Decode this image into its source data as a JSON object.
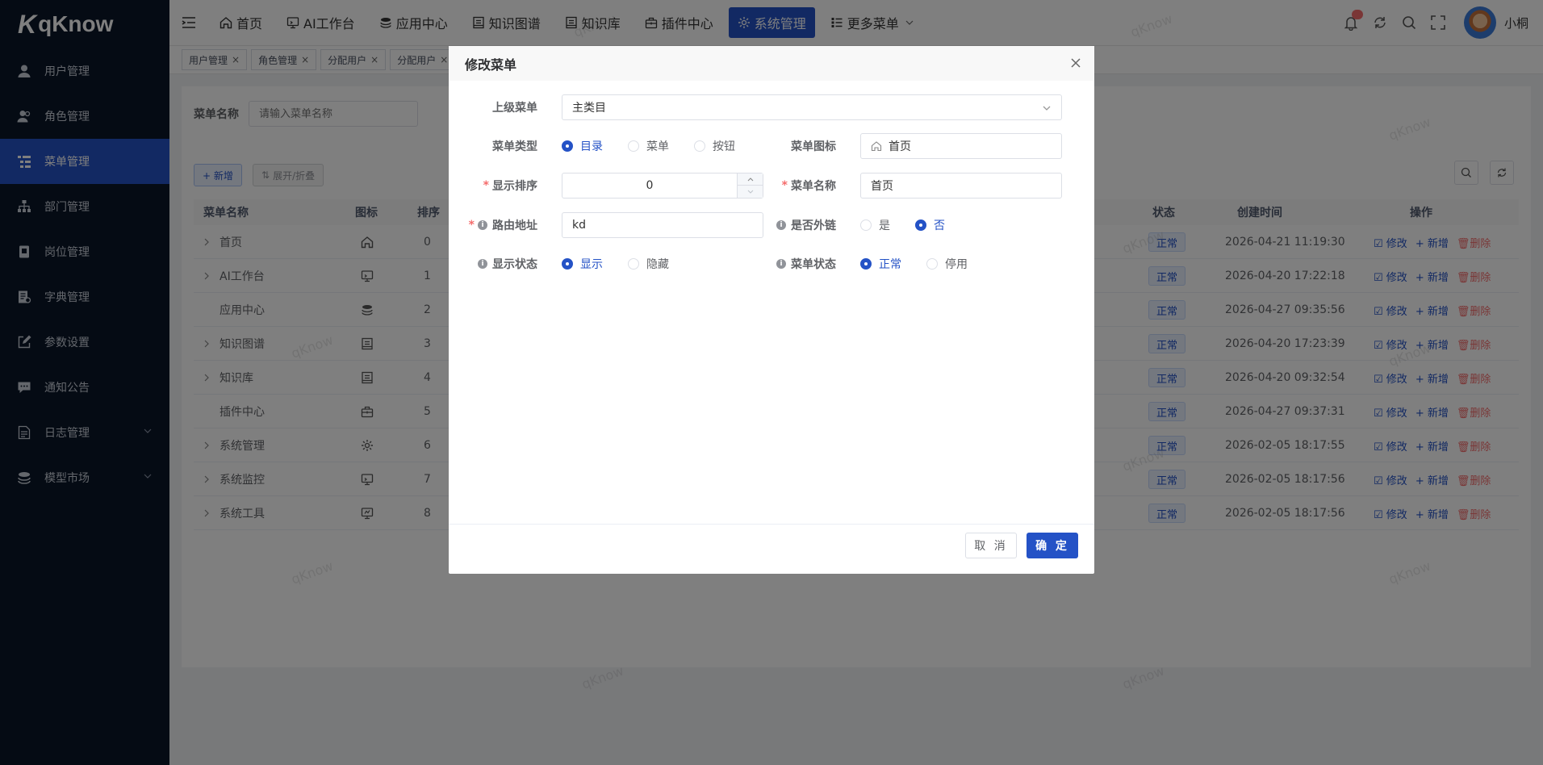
{
  "brand": {
    "name": "qKnow",
    "mark": "K"
  },
  "sidebar": {
    "items": [
      {
        "label": "用户管理",
        "icon": "user-icon"
      },
      {
        "label": "角色管理",
        "icon": "role-icon"
      },
      {
        "label": "菜单管理",
        "icon": "menu-tree-icon",
        "active": true
      },
      {
        "label": "部门管理",
        "icon": "org-chart-icon"
      },
      {
        "label": "岗位管理",
        "icon": "post-icon"
      },
      {
        "label": "字典管理",
        "icon": "dict-icon"
      },
      {
        "label": "参数设置",
        "icon": "edit-icon"
      },
      {
        "label": "通知公告",
        "icon": "message-icon"
      },
      {
        "label": "日志管理",
        "icon": "log-icon",
        "has_children": true
      },
      {
        "label": "模型市场",
        "icon": "model-icon",
        "has_children": true
      }
    ]
  },
  "topnav": {
    "items": [
      {
        "label": "首页",
        "icon": "home-icon"
      },
      {
        "label": "AI工作台",
        "icon": "monitor-icon"
      },
      {
        "label": "应用中心",
        "icon": "app-icon"
      },
      {
        "label": "知识图谱",
        "icon": "book-icon"
      },
      {
        "label": "知识库",
        "icon": "book-icon"
      },
      {
        "label": "插件中心",
        "icon": "plugin-icon"
      },
      {
        "label": "系统管理",
        "icon": "gear-icon",
        "active": true
      },
      {
        "label": "更多菜单",
        "icon": "list-icon",
        "dropdown": true
      }
    ],
    "user": "小桐"
  },
  "tags": [
    "用户管理",
    "角色管理",
    "分配用户",
    "分配用户"
  ],
  "search": {
    "label": "菜单名称",
    "placeholder": "请输入菜单名称"
  },
  "toolbar": {
    "add": "+ 新增",
    "expand": "展开/折叠"
  },
  "table": {
    "headers": {
      "name": "菜单名称",
      "icon": "图标",
      "order": "排序",
      "status": "状态",
      "created": "创建时间",
      "ops": "操作"
    },
    "rows": [
      {
        "name": "首页",
        "icon": "home-icon",
        "order": "0",
        "status": "正常",
        "created": "2026-04-21 11:19:30",
        "expandable": true
      },
      {
        "name": "AI工作台",
        "icon": "monitor-icon",
        "order": "1",
        "status": "正常",
        "created": "2026-04-20 17:22:18",
        "expandable": true
      },
      {
        "name": "应用中心",
        "icon": "app-icon",
        "order": "2",
        "status": "正常",
        "created": "2026-04-27 09:35:56",
        "expandable": false
      },
      {
        "name": "知识图谱",
        "icon": "book-icon",
        "order": "3",
        "status": "正常",
        "created": "2026-04-20 17:23:39",
        "expandable": true
      },
      {
        "name": "知识库",
        "icon": "book-icon",
        "order": "4",
        "status": "正常",
        "created": "2026-04-20 09:32:54",
        "expandable": true
      },
      {
        "name": "插件中心",
        "icon": "plugin-icon",
        "order": "5",
        "status": "正常",
        "created": "2026-04-27 09:37:31",
        "expandable": false
      },
      {
        "name": "系统管理",
        "icon": "gear-icon",
        "order": "6",
        "status": "正常",
        "created": "2026-02-05 18:17:55",
        "expandable": true
      },
      {
        "name": "系统监控",
        "icon": "monitor-icon",
        "order": "7",
        "status": "正常",
        "created": "2026-02-05 18:17:56",
        "expandable": true
      },
      {
        "name": "系统工具",
        "icon": "tool-icon",
        "order": "8",
        "status": "正常",
        "created": "2026-02-05 18:17:56",
        "expandable": true
      }
    ],
    "ops": {
      "edit": "修改",
      "add": "新增",
      "delete": "删除"
    }
  },
  "dialog": {
    "title": "修改菜单",
    "parent": {
      "label": "上级菜单",
      "value": "主类目"
    },
    "menu_type": {
      "label": "菜单类型",
      "options": [
        "目录",
        "菜单",
        "按钮"
      ],
      "selected": "目录"
    },
    "menu_icon": {
      "label": "菜单图标",
      "value": "首页",
      "icon": "home-icon"
    },
    "order": {
      "label": "显示排序",
      "value": "0"
    },
    "menu_name": {
      "label": "菜单名称",
      "value": "首页"
    },
    "route": {
      "label": "路由地址",
      "value": "kd"
    },
    "external": {
      "label": "是否外链",
      "options": [
        "是",
        "否"
      ],
      "selected": "否"
    },
    "visible": {
      "label": "显示状态",
      "options": [
        "显示",
        "隐藏"
      ],
      "selected": "显示"
    },
    "status": {
      "label": "菜单状态",
      "options": [
        "正常",
        "停用"
      ],
      "selected": "正常"
    },
    "cancel": "取 消",
    "confirm": "确 定"
  },
  "watermark": "qKnow",
  "colors": {
    "primary": "#2452c6",
    "sidebar_bg": "#0a1628",
    "danger": "#f56c6c"
  }
}
